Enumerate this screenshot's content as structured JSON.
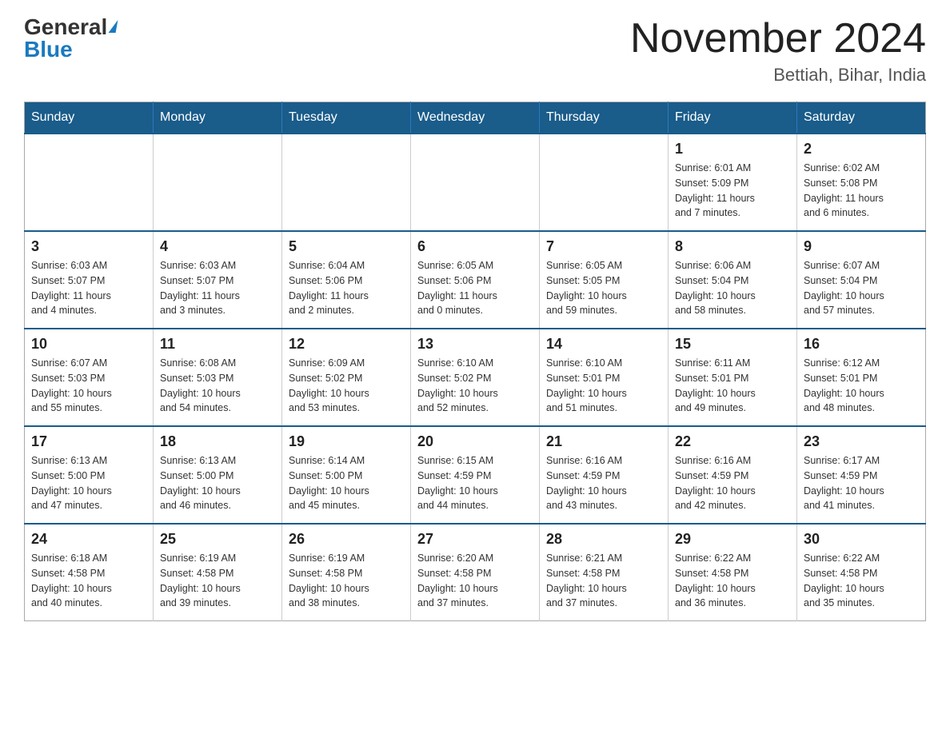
{
  "header": {
    "logo_general": "General",
    "logo_blue": "Blue",
    "month_title": "November 2024",
    "location": "Bettiah, Bihar, India"
  },
  "weekdays": [
    "Sunday",
    "Monday",
    "Tuesday",
    "Wednesday",
    "Thursday",
    "Friday",
    "Saturday"
  ],
  "weeks": [
    [
      {
        "day": "",
        "info": ""
      },
      {
        "day": "",
        "info": ""
      },
      {
        "day": "",
        "info": ""
      },
      {
        "day": "",
        "info": ""
      },
      {
        "day": "",
        "info": ""
      },
      {
        "day": "1",
        "info": "Sunrise: 6:01 AM\nSunset: 5:09 PM\nDaylight: 11 hours\nand 7 minutes."
      },
      {
        "day": "2",
        "info": "Sunrise: 6:02 AM\nSunset: 5:08 PM\nDaylight: 11 hours\nand 6 minutes."
      }
    ],
    [
      {
        "day": "3",
        "info": "Sunrise: 6:03 AM\nSunset: 5:07 PM\nDaylight: 11 hours\nand 4 minutes."
      },
      {
        "day": "4",
        "info": "Sunrise: 6:03 AM\nSunset: 5:07 PM\nDaylight: 11 hours\nand 3 minutes."
      },
      {
        "day": "5",
        "info": "Sunrise: 6:04 AM\nSunset: 5:06 PM\nDaylight: 11 hours\nand 2 minutes."
      },
      {
        "day": "6",
        "info": "Sunrise: 6:05 AM\nSunset: 5:06 PM\nDaylight: 11 hours\nand 0 minutes."
      },
      {
        "day": "7",
        "info": "Sunrise: 6:05 AM\nSunset: 5:05 PM\nDaylight: 10 hours\nand 59 minutes."
      },
      {
        "day": "8",
        "info": "Sunrise: 6:06 AM\nSunset: 5:04 PM\nDaylight: 10 hours\nand 58 minutes."
      },
      {
        "day": "9",
        "info": "Sunrise: 6:07 AM\nSunset: 5:04 PM\nDaylight: 10 hours\nand 57 minutes."
      }
    ],
    [
      {
        "day": "10",
        "info": "Sunrise: 6:07 AM\nSunset: 5:03 PM\nDaylight: 10 hours\nand 55 minutes."
      },
      {
        "day": "11",
        "info": "Sunrise: 6:08 AM\nSunset: 5:03 PM\nDaylight: 10 hours\nand 54 minutes."
      },
      {
        "day": "12",
        "info": "Sunrise: 6:09 AM\nSunset: 5:02 PM\nDaylight: 10 hours\nand 53 minutes."
      },
      {
        "day": "13",
        "info": "Sunrise: 6:10 AM\nSunset: 5:02 PM\nDaylight: 10 hours\nand 52 minutes."
      },
      {
        "day": "14",
        "info": "Sunrise: 6:10 AM\nSunset: 5:01 PM\nDaylight: 10 hours\nand 51 minutes."
      },
      {
        "day": "15",
        "info": "Sunrise: 6:11 AM\nSunset: 5:01 PM\nDaylight: 10 hours\nand 49 minutes."
      },
      {
        "day": "16",
        "info": "Sunrise: 6:12 AM\nSunset: 5:01 PM\nDaylight: 10 hours\nand 48 minutes."
      }
    ],
    [
      {
        "day": "17",
        "info": "Sunrise: 6:13 AM\nSunset: 5:00 PM\nDaylight: 10 hours\nand 47 minutes."
      },
      {
        "day": "18",
        "info": "Sunrise: 6:13 AM\nSunset: 5:00 PM\nDaylight: 10 hours\nand 46 minutes."
      },
      {
        "day": "19",
        "info": "Sunrise: 6:14 AM\nSunset: 5:00 PM\nDaylight: 10 hours\nand 45 minutes."
      },
      {
        "day": "20",
        "info": "Sunrise: 6:15 AM\nSunset: 4:59 PM\nDaylight: 10 hours\nand 44 minutes."
      },
      {
        "day": "21",
        "info": "Sunrise: 6:16 AM\nSunset: 4:59 PM\nDaylight: 10 hours\nand 43 minutes."
      },
      {
        "day": "22",
        "info": "Sunrise: 6:16 AM\nSunset: 4:59 PM\nDaylight: 10 hours\nand 42 minutes."
      },
      {
        "day": "23",
        "info": "Sunrise: 6:17 AM\nSunset: 4:59 PM\nDaylight: 10 hours\nand 41 minutes."
      }
    ],
    [
      {
        "day": "24",
        "info": "Sunrise: 6:18 AM\nSunset: 4:58 PM\nDaylight: 10 hours\nand 40 minutes."
      },
      {
        "day": "25",
        "info": "Sunrise: 6:19 AM\nSunset: 4:58 PM\nDaylight: 10 hours\nand 39 minutes."
      },
      {
        "day": "26",
        "info": "Sunrise: 6:19 AM\nSunset: 4:58 PM\nDaylight: 10 hours\nand 38 minutes."
      },
      {
        "day": "27",
        "info": "Sunrise: 6:20 AM\nSunset: 4:58 PM\nDaylight: 10 hours\nand 37 minutes."
      },
      {
        "day": "28",
        "info": "Sunrise: 6:21 AM\nSunset: 4:58 PM\nDaylight: 10 hours\nand 37 minutes."
      },
      {
        "day": "29",
        "info": "Sunrise: 6:22 AM\nSunset: 4:58 PM\nDaylight: 10 hours\nand 36 minutes."
      },
      {
        "day": "30",
        "info": "Sunrise: 6:22 AM\nSunset: 4:58 PM\nDaylight: 10 hours\nand 35 minutes."
      }
    ]
  ]
}
